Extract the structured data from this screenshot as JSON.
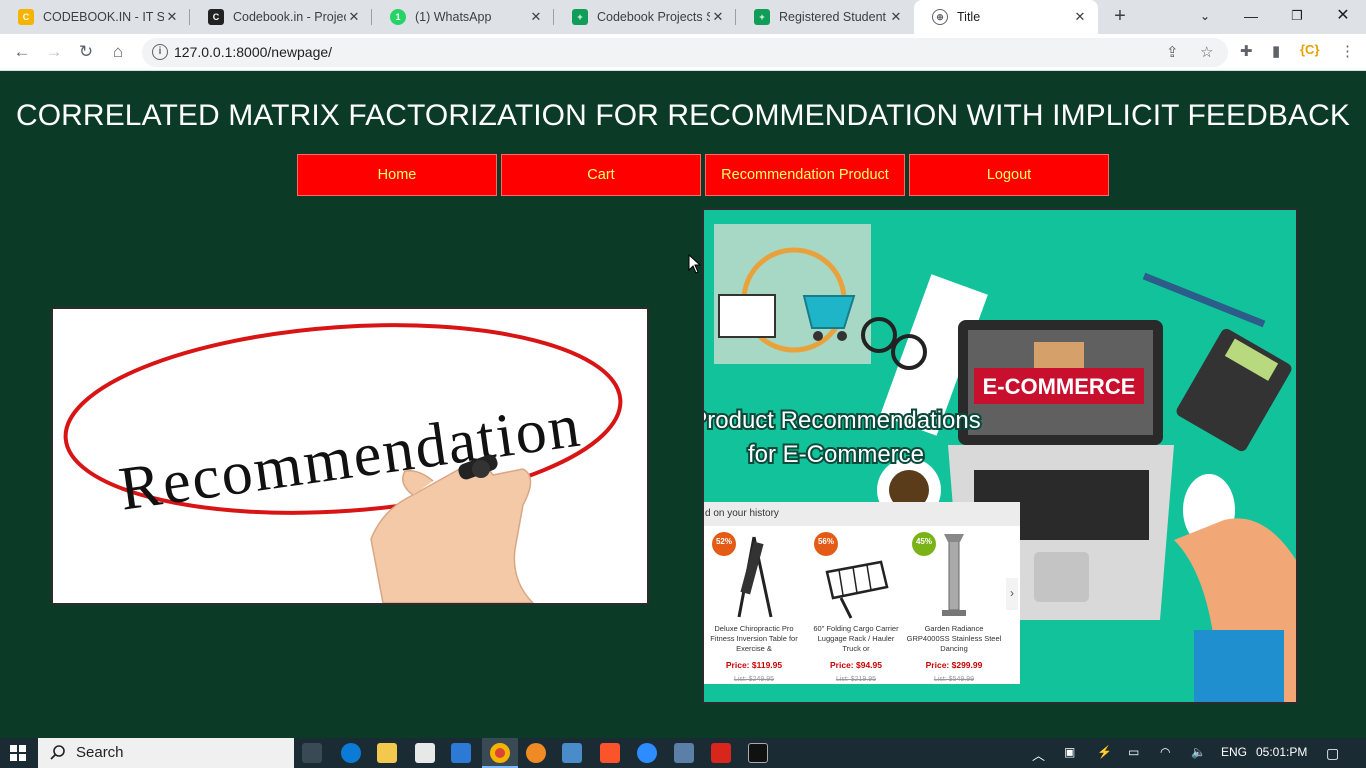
{
  "browser": {
    "tabs": [
      {
        "title": "CODEBOOK.IN - IT SEI",
        "favicon_color": "#f4b400"
      },
      {
        "title": "Codebook.in - Project",
        "favicon_color": "#222222"
      },
      {
        "title": "(1) WhatsApp",
        "favicon_color": "#25d366"
      },
      {
        "title": "Codebook Projects Sta",
        "favicon_color": "#0f9d58"
      },
      {
        "title": "Registered Student De",
        "favicon_color": "#0f9d58"
      },
      {
        "title": "Title",
        "favicon_color": "#5f6368"
      }
    ],
    "url": "127.0.0.1:8000/newpage/"
  },
  "page": {
    "heading": "CORRELATED MATRIX FACTORIZATION FOR RECOMMENDATION WITH IMPLICIT FEEDBACK",
    "nav": [
      {
        "label": "Home"
      },
      {
        "label": "Cart"
      },
      {
        "label": "Recommendation Product"
      },
      {
        "label": "Logout"
      }
    ],
    "left_image": {
      "text": "Recommendation"
    },
    "right_image": {
      "title_line1": "Product Recommendations",
      "title_line2": "for E-Commerce",
      "laptop_text": "E-COMMERCE",
      "panel_header": "d on your history",
      "products": [
        {
          "badge": "52%",
          "name": "Deluxe Chiropractic Pro Fitness Inversion Table for Exercise &",
          "price": "Price: $119.95",
          "list": "List: $249.95"
        },
        {
          "badge": "56%",
          "name": "60\" Folding Cargo Carrier Luggage Rack / Hauler Truck or",
          "price": "Price: $94.95",
          "list": "List: $219.95"
        },
        {
          "badge": "45%",
          "name": "Garden Radiance GRP4000SS Stainless Steel Dancing",
          "price": "Price: $299.99",
          "list": "List: $549.99"
        }
      ]
    }
  },
  "taskbar": {
    "search_placeholder": "Search",
    "language": "ENG",
    "time": "05:01:PM"
  }
}
